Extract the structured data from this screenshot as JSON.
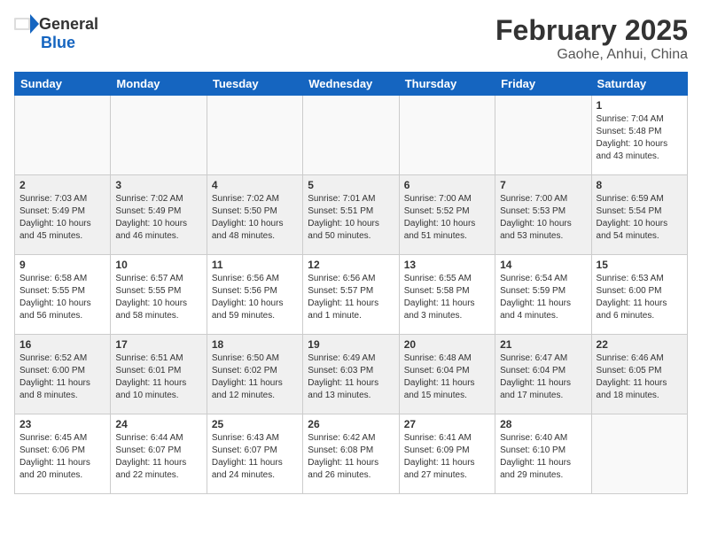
{
  "header": {
    "logo_general": "General",
    "logo_blue": "Blue",
    "month": "February 2025",
    "location": "Gaohe, Anhui, China"
  },
  "weekdays": [
    "Sunday",
    "Monday",
    "Tuesday",
    "Wednesday",
    "Thursday",
    "Friday",
    "Saturday"
  ],
  "weeks": [
    {
      "shaded": false,
      "days": [
        {
          "num": "",
          "detail": ""
        },
        {
          "num": "",
          "detail": ""
        },
        {
          "num": "",
          "detail": ""
        },
        {
          "num": "",
          "detail": ""
        },
        {
          "num": "",
          "detail": ""
        },
        {
          "num": "",
          "detail": ""
        },
        {
          "num": "1",
          "detail": "Sunrise: 7:04 AM\nSunset: 5:48 PM\nDaylight: 10 hours and 43 minutes."
        }
      ]
    },
    {
      "shaded": true,
      "days": [
        {
          "num": "2",
          "detail": "Sunrise: 7:03 AM\nSunset: 5:49 PM\nDaylight: 10 hours and 45 minutes."
        },
        {
          "num": "3",
          "detail": "Sunrise: 7:02 AM\nSunset: 5:49 PM\nDaylight: 10 hours and 46 minutes."
        },
        {
          "num": "4",
          "detail": "Sunrise: 7:02 AM\nSunset: 5:50 PM\nDaylight: 10 hours and 48 minutes."
        },
        {
          "num": "5",
          "detail": "Sunrise: 7:01 AM\nSunset: 5:51 PM\nDaylight: 10 hours and 50 minutes."
        },
        {
          "num": "6",
          "detail": "Sunrise: 7:00 AM\nSunset: 5:52 PM\nDaylight: 10 hours and 51 minutes."
        },
        {
          "num": "7",
          "detail": "Sunrise: 7:00 AM\nSunset: 5:53 PM\nDaylight: 10 hours and 53 minutes."
        },
        {
          "num": "8",
          "detail": "Sunrise: 6:59 AM\nSunset: 5:54 PM\nDaylight: 10 hours and 54 minutes."
        }
      ]
    },
    {
      "shaded": false,
      "days": [
        {
          "num": "9",
          "detail": "Sunrise: 6:58 AM\nSunset: 5:55 PM\nDaylight: 10 hours and 56 minutes."
        },
        {
          "num": "10",
          "detail": "Sunrise: 6:57 AM\nSunset: 5:55 PM\nDaylight: 10 hours and 58 minutes."
        },
        {
          "num": "11",
          "detail": "Sunrise: 6:56 AM\nSunset: 5:56 PM\nDaylight: 10 hours and 59 minutes."
        },
        {
          "num": "12",
          "detail": "Sunrise: 6:56 AM\nSunset: 5:57 PM\nDaylight: 11 hours and 1 minute."
        },
        {
          "num": "13",
          "detail": "Sunrise: 6:55 AM\nSunset: 5:58 PM\nDaylight: 11 hours and 3 minutes."
        },
        {
          "num": "14",
          "detail": "Sunrise: 6:54 AM\nSunset: 5:59 PM\nDaylight: 11 hours and 4 minutes."
        },
        {
          "num": "15",
          "detail": "Sunrise: 6:53 AM\nSunset: 6:00 PM\nDaylight: 11 hours and 6 minutes."
        }
      ]
    },
    {
      "shaded": true,
      "days": [
        {
          "num": "16",
          "detail": "Sunrise: 6:52 AM\nSunset: 6:00 PM\nDaylight: 11 hours and 8 minutes."
        },
        {
          "num": "17",
          "detail": "Sunrise: 6:51 AM\nSunset: 6:01 PM\nDaylight: 11 hours and 10 minutes."
        },
        {
          "num": "18",
          "detail": "Sunrise: 6:50 AM\nSunset: 6:02 PM\nDaylight: 11 hours and 12 minutes."
        },
        {
          "num": "19",
          "detail": "Sunrise: 6:49 AM\nSunset: 6:03 PM\nDaylight: 11 hours and 13 minutes."
        },
        {
          "num": "20",
          "detail": "Sunrise: 6:48 AM\nSunset: 6:04 PM\nDaylight: 11 hours and 15 minutes."
        },
        {
          "num": "21",
          "detail": "Sunrise: 6:47 AM\nSunset: 6:04 PM\nDaylight: 11 hours and 17 minutes."
        },
        {
          "num": "22",
          "detail": "Sunrise: 6:46 AM\nSunset: 6:05 PM\nDaylight: 11 hours and 18 minutes."
        }
      ]
    },
    {
      "shaded": false,
      "days": [
        {
          "num": "23",
          "detail": "Sunrise: 6:45 AM\nSunset: 6:06 PM\nDaylight: 11 hours and 20 minutes."
        },
        {
          "num": "24",
          "detail": "Sunrise: 6:44 AM\nSunset: 6:07 PM\nDaylight: 11 hours and 22 minutes."
        },
        {
          "num": "25",
          "detail": "Sunrise: 6:43 AM\nSunset: 6:07 PM\nDaylight: 11 hours and 24 minutes."
        },
        {
          "num": "26",
          "detail": "Sunrise: 6:42 AM\nSunset: 6:08 PM\nDaylight: 11 hours and 26 minutes."
        },
        {
          "num": "27",
          "detail": "Sunrise: 6:41 AM\nSunset: 6:09 PM\nDaylight: 11 hours and 27 minutes."
        },
        {
          "num": "28",
          "detail": "Sunrise: 6:40 AM\nSunset: 6:10 PM\nDaylight: 11 hours and 29 minutes."
        },
        {
          "num": "",
          "detail": ""
        }
      ]
    }
  ]
}
